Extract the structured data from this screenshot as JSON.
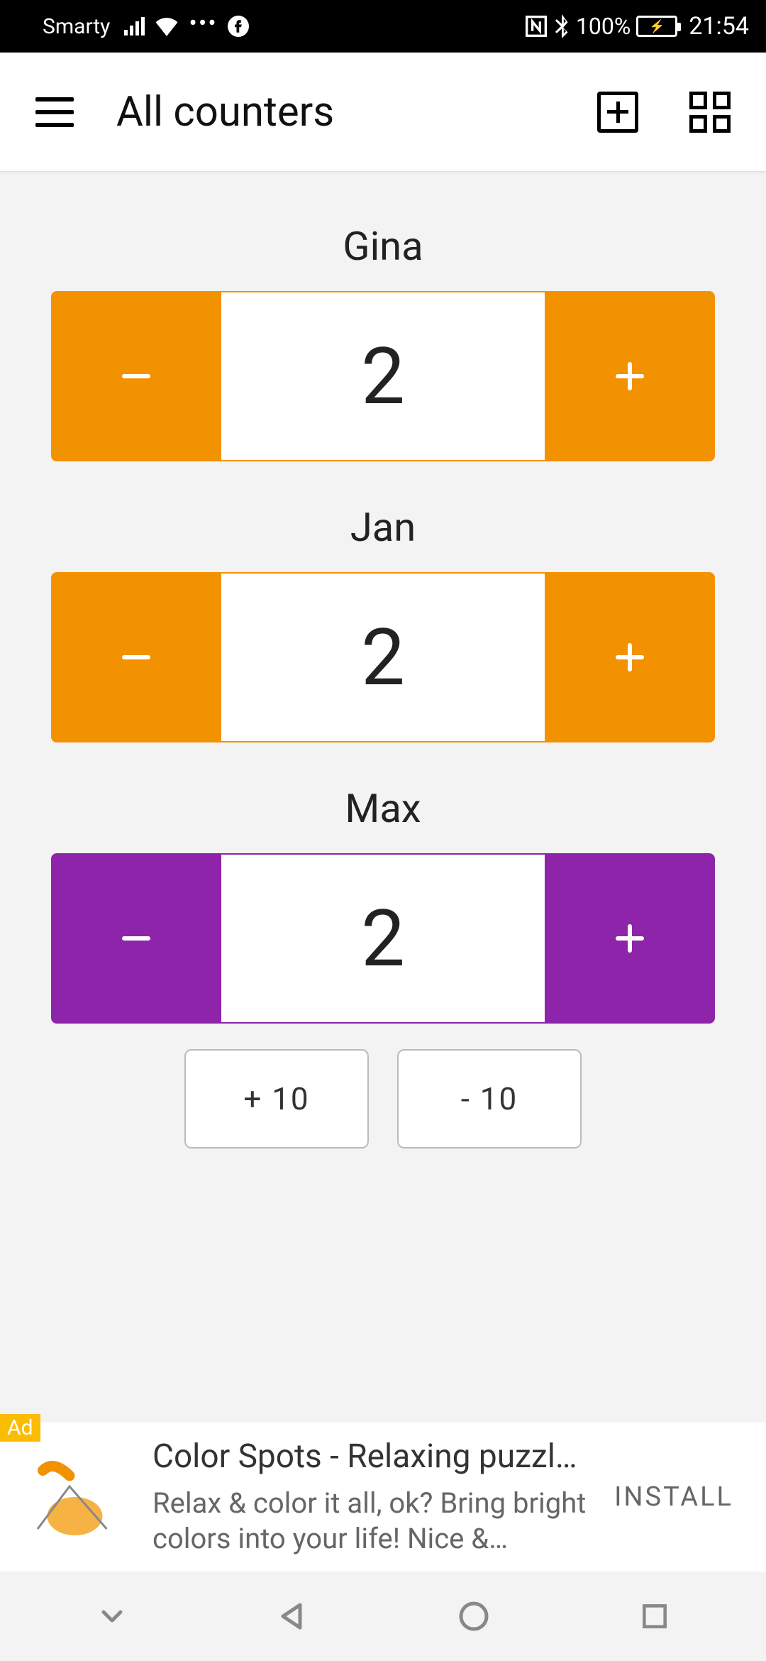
{
  "status": {
    "carrier": "Smarty",
    "battery_pct": "100%",
    "time": "21:54"
  },
  "header": {
    "title": "All counters"
  },
  "counters": [
    {
      "name": "Gina",
      "value": "2",
      "color": "orange"
    },
    {
      "name": "Jan",
      "value": "2",
      "color": "orange"
    },
    {
      "name": "Max",
      "value": "2",
      "color": "purple"
    }
  ],
  "step_buttons": {
    "plus10": "+ 10",
    "minus10": "- 10"
  },
  "ad": {
    "badge": "Ad",
    "title": "Color Spots - Relaxing puzzle with d…",
    "desc": "Relax & color it all, ok? Bring bright colors into your life! Nice & relaxing …",
    "cta": "INSTALL"
  }
}
